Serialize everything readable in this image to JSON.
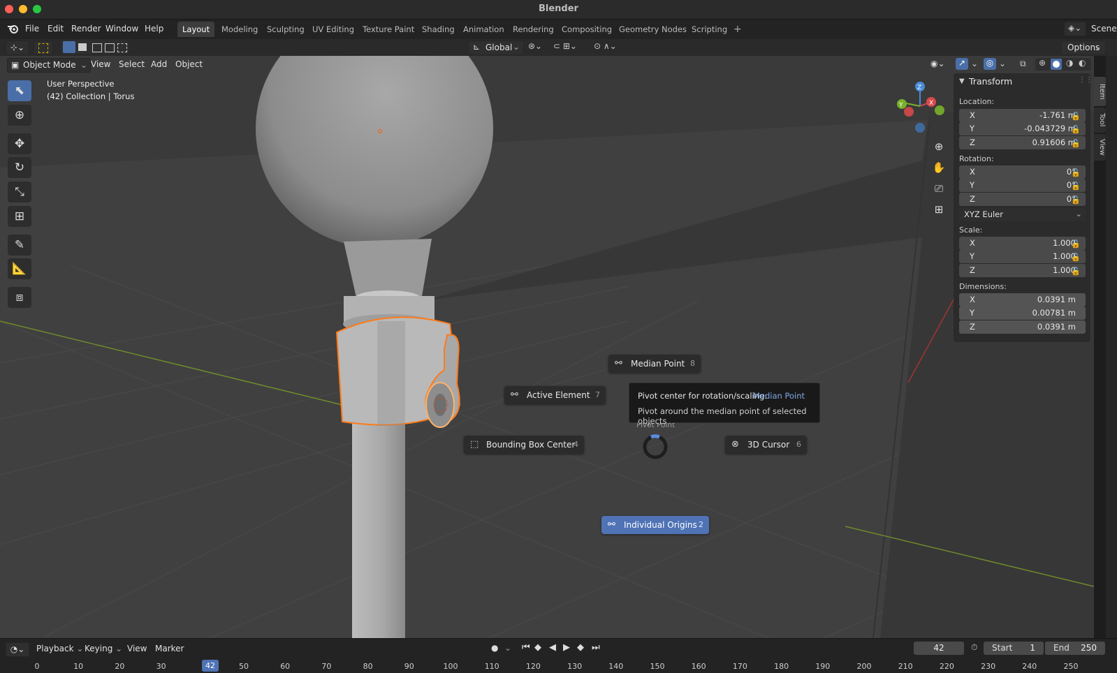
{
  "app": {
    "title": "Blender"
  },
  "menu": [
    "File",
    "Edit",
    "Render",
    "Window",
    "Help"
  ],
  "workspaces": [
    "Layout",
    "Modeling",
    "Sculpting",
    "UV Editing",
    "Texture Paint",
    "Shading",
    "Animation",
    "Rendering",
    "Compositing",
    "Geometry Nodes",
    "Scripting"
  ],
  "active_workspace": "Layout",
  "scene_label": "Scene",
  "toolbar": {
    "orientation": "Global",
    "options": "Options"
  },
  "viewport_header": {
    "mode": "Object Mode",
    "view": "View",
    "select": "Select",
    "add": "Add",
    "object": "Object"
  },
  "overlay_text": {
    "perspective": "User Perspective",
    "collection": "(42) Collection | Torus"
  },
  "gizmo_axes": {
    "x": "X",
    "y": "Y",
    "z": "Z"
  },
  "side_tabs": [
    "Item",
    "Tool",
    "View"
  ],
  "transform": {
    "title": "Transform",
    "location_label": "Location:",
    "location": [
      {
        "axis": "X",
        "value": "-1.761 m"
      },
      {
        "axis": "Y",
        "value": "-0.043729 m"
      },
      {
        "axis": "Z",
        "value": "0.91606 m"
      }
    ],
    "rotation_label": "Rotation:",
    "rotation": [
      {
        "axis": "X",
        "value": "0°"
      },
      {
        "axis": "Y",
        "value": "0°"
      },
      {
        "axis": "Z",
        "value": "0°"
      }
    ],
    "rotation_mode": "XYZ Euler",
    "scale_label": "Scale:",
    "scale": [
      {
        "axis": "X",
        "value": "1.000"
      },
      {
        "axis": "Y",
        "value": "1.000"
      },
      {
        "axis": "Z",
        "value": "1.000"
      }
    ],
    "dimensions_label": "Dimensions:",
    "dimensions": [
      {
        "axis": "X",
        "value": "0.0391 m"
      },
      {
        "axis": "Y",
        "value": "0.00781 m"
      },
      {
        "axis": "Z",
        "value": "0.0391 m"
      }
    ]
  },
  "pie_menu": {
    "title": "Pivot Point",
    "median": {
      "label": "Median Point",
      "key": "8"
    },
    "active": {
      "label": "Active Element",
      "key": "7"
    },
    "bbox": {
      "label": "Bounding Box Center",
      "key": "4"
    },
    "cursor": {
      "label": "3D Cursor",
      "key": "6"
    },
    "individual": {
      "label": "Individual Origins",
      "key": "2"
    }
  },
  "tooltip": {
    "line1_prefix": "Pivot center for rotation/scaling:",
    "line1_value": "Median Point",
    "line2": "Pivot around the median point of selected objects"
  },
  "timeline": {
    "playback": "Playback",
    "keying": "Keying",
    "view": "View",
    "marker": "Marker",
    "current_frame": "42",
    "start_label": "Start",
    "start": "1",
    "end_label": "End",
    "end": "250",
    "ruler_ticks": [
      "0",
      "10",
      "20",
      "30",
      "4",
      "50",
      "60",
      "70",
      "80",
      "90",
      "100",
      "110",
      "120",
      "130",
      "140",
      "150",
      "160",
      "170",
      "180",
      "190",
      "200",
      "210",
      "220",
      "230",
      "240",
      "250"
    ],
    "playhead": "42"
  }
}
